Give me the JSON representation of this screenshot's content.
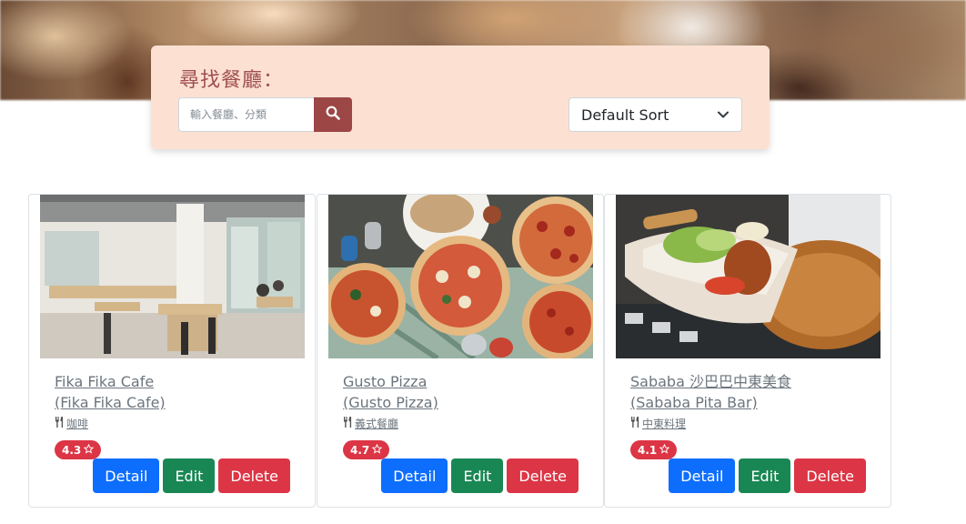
{
  "search": {
    "title": "尋找餐廳：",
    "placeholder": "輸入餐廳、分類",
    "button_icon": "search-icon"
  },
  "sort": {
    "selected": "Default Sort",
    "icon": "chevron-down-icon"
  },
  "colors": {
    "panel_bg": "#fce1d2",
    "search_button": "#9c4646",
    "rating_badge": "#dc3545",
    "detail_button": "#0d6efd",
    "edit_button": "#198754",
    "delete_button": "#dc3545"
  },
  "restaurants": [
    {
      "name": "Fika Fika Cafe",
      "name_en": "(Fika Fika Cafe)",
      "category": "咖啡",
      "rating": "4.3",
      "image": "cafe-interior-photo"
    },
    {
      "name": "Gusto Pizza",
      "name_en": "(Gusto Pizza)",
      "category": "義式餐廳",
      "rating": "4.7",
      "image": "pizza-photo"
    },
    {
      "name": "Sababa 沙巴巴中東美食",
      "name_en": "(Sababa Pita Bar)",
      "category": "中東料理",
      "rating": "4.1",
      "image": "pita-wrap-photo"
    }
  ],
  "actions": {
    "detail": "Detail",
    "edit": "Edit",
    "delete": "Delete"
  }
}
